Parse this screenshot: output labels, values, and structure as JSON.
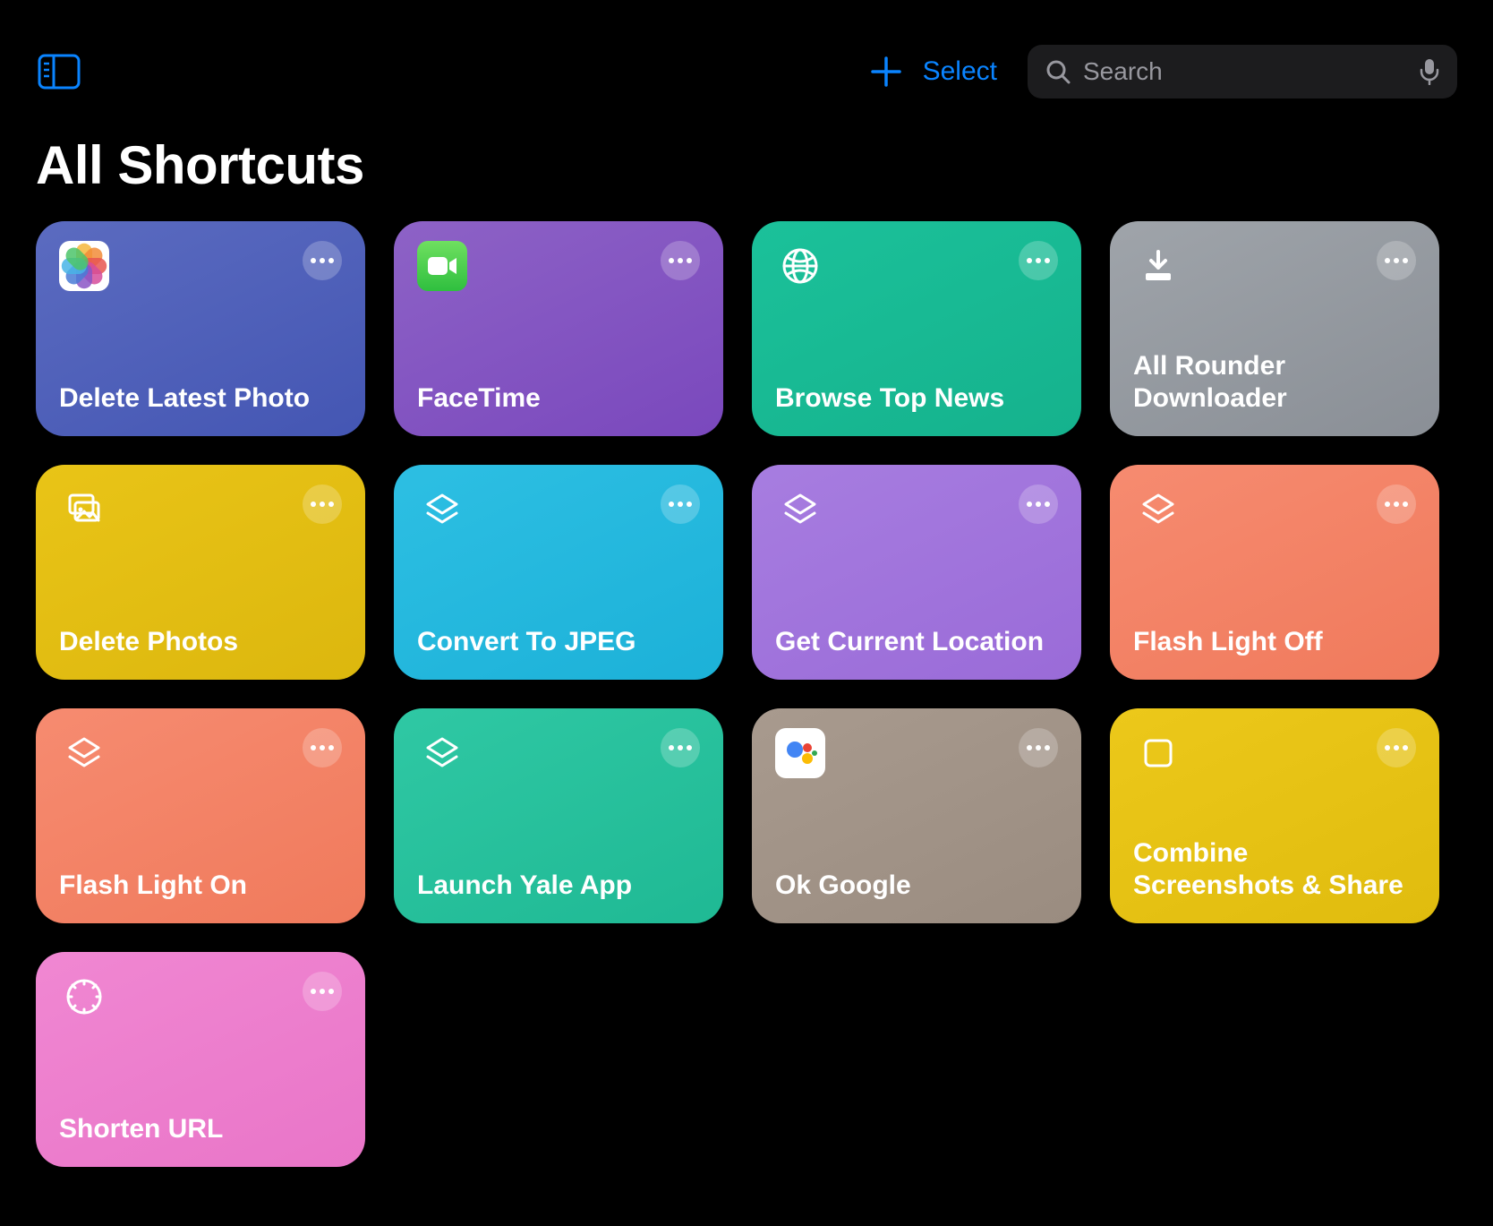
{
  "toolbar": {
    "select_label": "Select",
    "search_placeholder": "Search"
  },
  "page_title": "All Shortcuts",
  "shortcuts": [
    {
      "label": "Delete Latest Photo",
      "icon": "photos-app-icon",
      "gradient": "g-blue"
    },
    {
      "label": "FaceTime",
      "icon": "facetime-app-icon",
      "gradient": "g-purple"
    },
    {
      "label": "Browse Top News",
      "icon": "globe-icon",
      "gradient": "g-teal"
    },
    {
      "label": "All Rounder Downloader",
      "icon": "download-icon",
      "gradient": "g-gray"
    },
    {
      "label": "Delete Photos",
      "icon": "photos-stack-icon",
      "gradient": "g-yellow"
    },
    {
      "label": "Convert To JPEG",
      "icon": "layers-icon",
      "gradient": "g-cyan"
    },
    {
      "label": "Get Current Location",
      "icon": "layers-icon",
      "gradient": "g-lilac"
    },
    {
      "label": "Flash Light Off",
      "icon": "layers-icon",
      "gradient": "g-salmon"
    },
    {
      "label": "Flash Light On",
      "icon": "layers-icon",
      "gradient": "g-salmon"
    },
    {
      "label": "Launch Yale App",
      "icon": "layers-icon",
      "gradient": "g-teal2"
    },
    {
      "label": "Ok Google",
      "icon": "assistant-app-icon",
      "gradient": "g-taupe"
    },
    {
      "label": "Combine Screenshots & Share",
      "icon": "square-icon",
      "gradient": "g-gold"
    },
    {
      "label": "Shorten URL",
      "icon": "safari-icon",
      "gradient": "g-pink"
    }
  ]
}
